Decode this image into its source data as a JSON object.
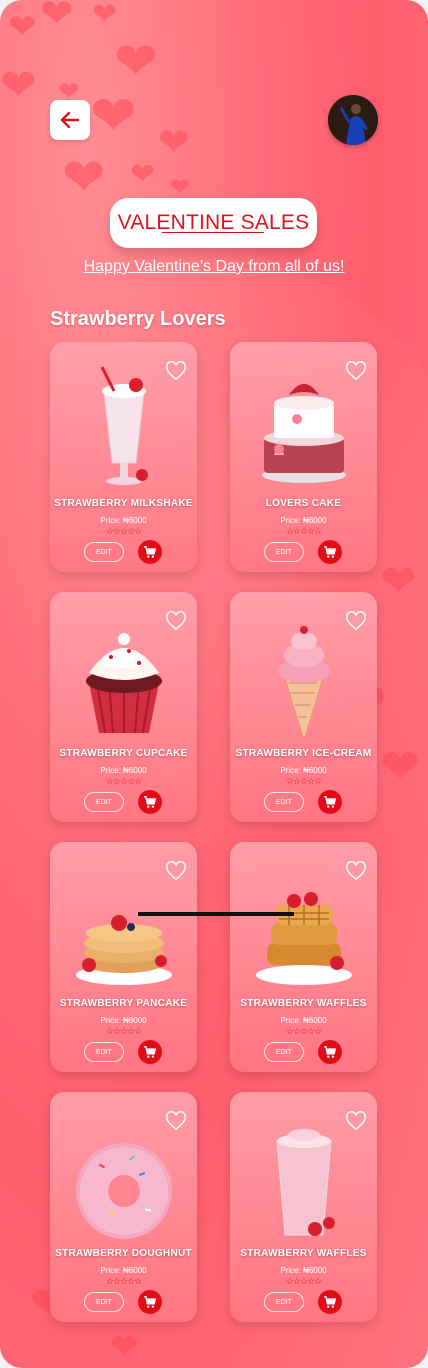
{
  "header": {
    "title": "VALENTINE SALES",
    "subtitle": "Happy Valentine’s Day from all of us!"
  },
  "section": {
    "title": "Strawberry Lovers"
  },
  "products": [
    {
      "name": "STRAWBERRY MILKSHAKE",
      "price": "Price: ₦6000",
      "stars": "☆☆☆☆☆",
      "edit": "EDIT",
      "image": "milkshake"
    },
    {
      "name": "LOVERS CAKE",
      "price": "Price: ₦6000",
      "stars": "☆☆☆☆☆",
      "edit": "EDIT",
      "image": "cake"
    },
    {
      "name": "STRAWBERRY CUPCAKE",
      "price": "Price: ₦6000",
      "stars": "☆☆☆☆☆",
      "edit": "EDIT",
      "image": "cupcake"
    },
    {
      "name": "STRAWBERRY ICE-CREAM",
      "price": "Price: ₦6000",
      "stars": "☆☆☆☆☆",
      "edit": "EDIT",
      "image": "icecream"
    },
    {
      "name": "STRAWBERRY PANCAKE",
      "price": "Price: ₦6000",
      "stars": "☆☆☆☆☆",
      "edit": "EDIT",
      "image": "pancake"
    },
    {
      "name": "STRAWBERRY WAFFLES",
      "price": "Price: ₦6000",
      "stars": "☆☆☆☆☆",
      "edit": "EDIT",
      "image": "waffles"
    },
    {
      "name": "STRAWBERRY DOUGHNUT",
      "price": "Price: ₦6000",
      "stars": "☆☆☆☆☆",
      "edit": "EDIT",
      "image": "doughnut"
    },
    {
      "name": "STRAWBERRY WAFFLES",
      "price": "Price: ₦6000",
      "stars": "☆☆☆☆☆",
      "edit": "EDIT",
      "image": "smoothie"
    }
  ],
  "colors": {
    "accent": "#e30b17",
    "background": "#ff6e7a",
    "white": "#ffffff"
  },
  "icons": {
    "back": "arrow-left-icon",
    "favorite": "heart-outline-icon",
    "cart": "shopping-cart-icon"
  }
}
